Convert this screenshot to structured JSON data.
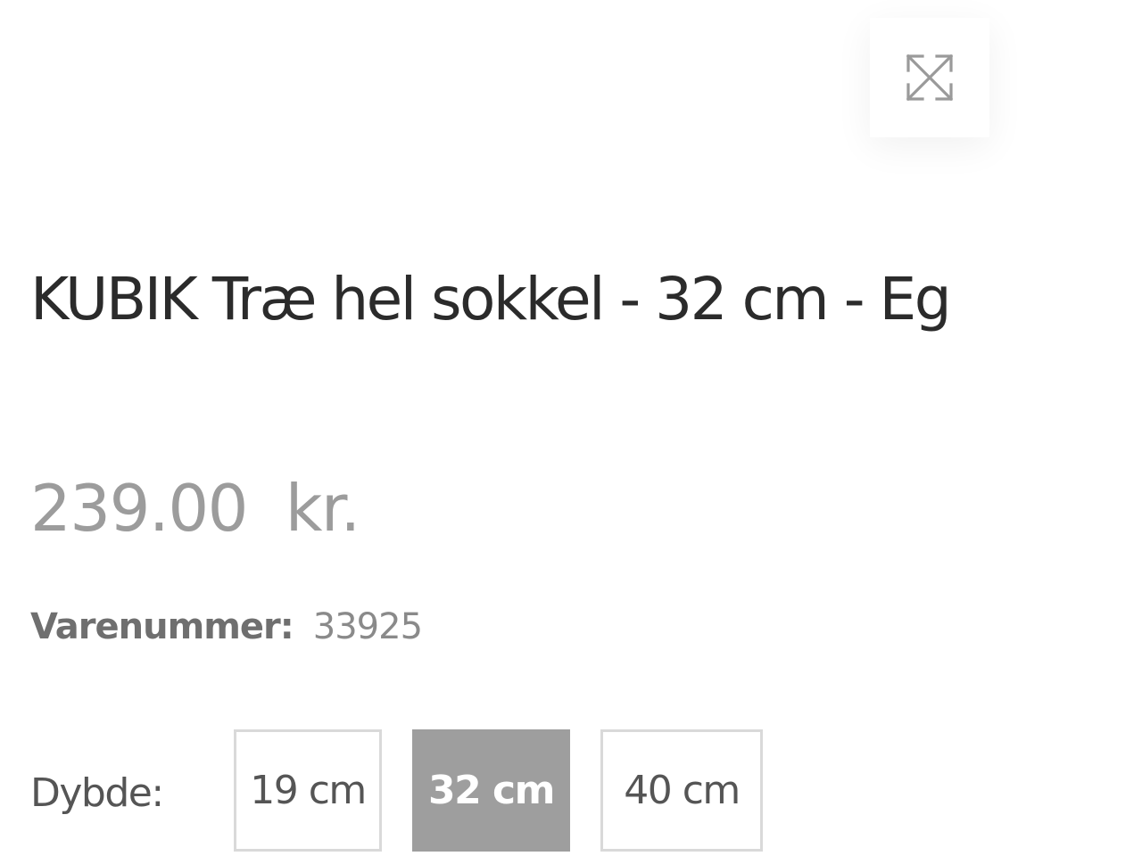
{
  "expand": {
    "icon": "expand-arrows-icon"
  },
  "product": {
    "title": "KUBIK Træ hel sokkel - 32 cm - Eg",
    "price": "239.00  kr.",
    "sku_label": "Varenummer:",
    "sku_value": "33925"
  },
  "depth": {
    "label": "Dybde:",
    "options": [
      {
        "label": "19 cm",
        "selected": false
      },
      {
        "label": "32 cm",
        "selected": true
      },
      {
        "label": "40 cm",
        "selected": false
      }
    ]
  },
  "colors": {
    "title": "#2b2b2b",
    "price": "#9c9c9c",
    "selected_option_bg": "#9e9e9e",
    "option_border": "#d9d9d9"
  }
}
